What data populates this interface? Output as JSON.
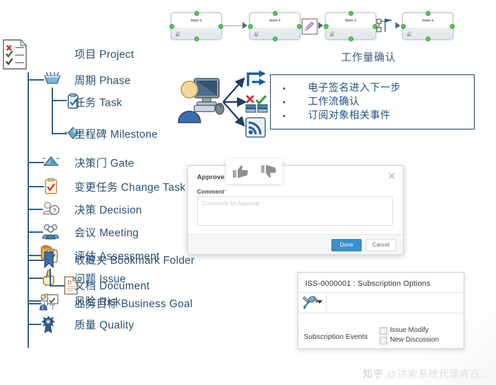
{
  "workflow": {
    "states": [
      {
        "label": "State 1"
      },
      {
        "label": "State 2"
      },
      {
        "label": "State 3"
      },
      {
        "label": "State 4"
      }
    ],
    "caption": "工作量确认",
    "signature_icon": "pencil-signature-icon",
    "branch_icon": "branch-flag-icon"
  },
  "tree": {
    "root": {
      "label": "项目 Project",
      "icon": "project-checklist-icon"
    },
    "items": [
      {
        "label": "周期 Phase",
        "icon": "phase-icon",
        "level": 1
      },
      {
        "label": "任务 Task",
        "icon": "task-clipboard-icon",
        "level": 2
      },
      {
        "label": "里程碑 Milestone",
        "icon": "milestone-diamond-icon",
        "level": 2
      },
      {
        "label": "决策门 Gate",
        "icon": "gate-icon",
        "level": 1
      },
      {
        "label": "变更任务 Change Task",
        "icon": "change-task-icon",
        "level": 1
      },
      {
        "label": "决策 Decision",
        "icon": "decision-icon",
        "level": 1
      },
      {
        "label": "会议 Meeting",
        "icon": "meeting-people-icon",
        "level": 1
      },
      {
        "label": "评估 Assessment",
        "icon": "assessment-icon",
        "level": 1
      },
      {
        "label": "问题 Issue",
        "icon": "issue-hand-icon",
        "level": 1
      },
      {
        "label": "风险 Risk",
        "icon": "risk-cloud-icon",
        "level": 1
      },
      {
        "label": "收藏夹 Bookmark Folder",
        "icon": "bookmark-icon",
        "level": 1
      },
      {
        "label": "文档 Document",
        "icon": "document-icon",
        "level": 2
      },
      {
        "label": "业务目标 Business Goal",
        "icon": "business-goal-icon",
        "level": 1
      },
      {
        "label": "质量 Quality",
        "icon": "quality-ribbon-icon",
        "level": 1
      }
    ]
  },
  "cluster": {
    "user_icon": "user-at-computer-icon",
    "targets": [
      {
        "icon": "workflow-route-icon"
      },
      {
        "icon": "approve-reject-icon"
      },
      {
        "icon": "subscribe-rss-icon"
      }
    ]
  },
  "callout": {
    "bullets": [
      "电子签名进入下一步",
      "工作流确认",
      "订阅对象相关事件"
    ],
    "border_color": "#1f3f63",
    "text_color": "#24507f"
  },
  "approve_dialog": {
    "title": "Approve",
    "close_icon": "close-icon",
    "comment_label": "Comment",
    "required_marker": "*",
    "comment_value": "",
    "comment_placeholder": "Comments for Approval",
    "done_label": "Done",
    "cancel_label": "Cancel",
    "done_color": "#3d8fc6",
    "thumbs": [
      {
        "icon": "thumbs-up-icon"
      },
      {
        "icon": "thumbs-down-icon"
      }
    ]
  },
  "subscription_panel": {
    "title": "ISS-0000001 : Subscription Options",
    "toolbar_icon": "tools-dropdown-icon",
    "events_label": "Subscription Events",
    "options": [
      {
        "label": "Issue Modify",
        "checked": false
      },
      {
        "label": "New Discussion",
        "checked": false
      }
    ]
  },
  "watermark": {
    "brand": "知乎",
    "handle": "@达索系统代理商百…"
  }
}
